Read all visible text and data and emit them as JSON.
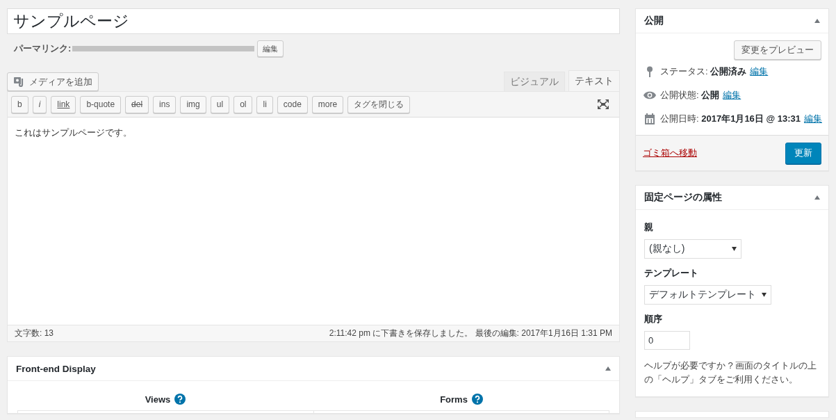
{
  "title_field": {
    "value": "サンプルページ"
  },
  "permalink": {
    "label": "パーマリンク:",
    "edit_button": "編集"
  },
  "media_button": "メディアを追加",
  "editor_tabs": [
    {
      "label": "ビジュアル",
      "selected": false
    },
    {
      "label": "テキスト",
      "selected": true
    }
  ],
  "toolbar_buttons": [
    {
      "label": "b",
      "kind": "plain"
    },
    {
      "label": "i",
      "kind": "italic"
    },
    {
      "label": "link",
      "kind": "underline"
    },
    {
      "label": "b-quote",
      "kind": "plain"
    },
    {
      "label": "del",
      "kind": "strike"
    },
    {
      "label": "ins",
      "kind": "plain"
    },
    {
      "label": "img",
      "kind": "plain"
    },
    {
      "label": "ul",
      "kind": "plain"
    },
    {
      "label": "ol",
      "kind": "plain"
    },
    {
      "label": "li",
      "kind": "plain"
    },
    {
      "label": "code",
      "kind": "plain"
    },
    {
      "label": "more",
      "kind": "plain"
    },
    {
      "label": "タグを閉じる",
      "kind": "plain"
    }
  ],
  "content": "これはサンプルページです。",
  "status_bar": {
    "word_count": "文字数: 13",
    "saved": "2:11:42 pm に下書きを保存しました。 最後の編集: 2017年1月16日 1:31 PM"
  },
  "front_end_display": {
    "title": "Front-end Display",
    "columns": [
      "Views",
      "Forms"
    ]
  },
  "publish": {
    "title": "公開",
    "preview_button": "変更をプレビュー",
    "rows": [
      {
        "kind": "status",
        "label": "ステータス:",
        "value": "公開済み",
        "link": "編集"
      },
      {
        "kind": "visibility",
        "label": "公開状態:",
        "value": "公開",
        "link": "編集"
      },
      {
        "kind": "date",
        "label": "公開日時:",
        "value": "2017年1月16日 @ 13:31",
        "link": "編集"
      }
    ],
    "trash_link": "ゴミ箱へ移動",
    "update_button": "更新"
  },
  "page_attributes": {
    "title": "固定ページの属性",
    "parent_label": "親",
    "parent_value": "(親なし)",
    "template_label": "テンプレート",
    "template_value": "デフォルトテンプレート",
    "order_label": "順序",
    "order_value": "0",
    "help": "ヘルプが必要ですか ? 画面のタイトルの上の「ヘルプ」タブをご利用ください。"
  }
}
